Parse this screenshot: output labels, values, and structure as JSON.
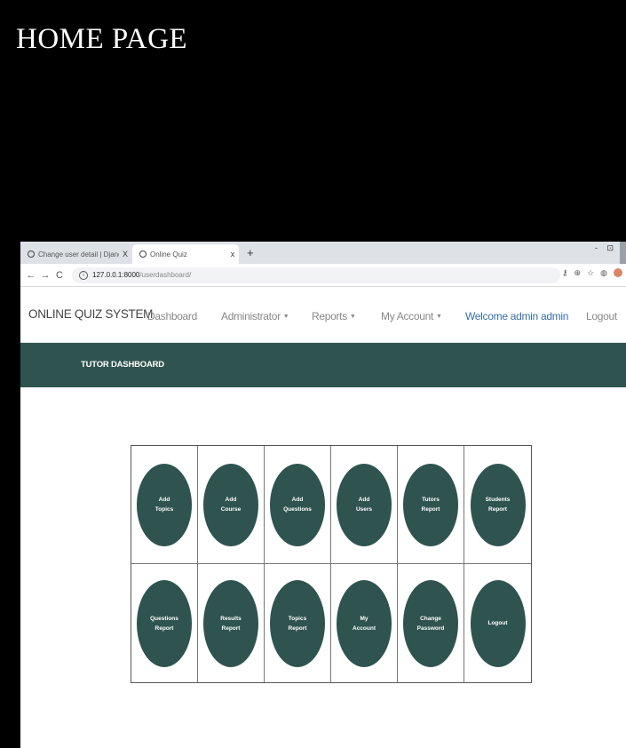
{
  "heading": "HOME PAGE",
  "browser": {
    "tabs": [
      {
        "label": "Change user detail | Django site",
        "close": "X"
      },
      {
        "label": "Online Quiz",
        "close": "x"
      }
    ],
    "new_tab": "+",
    "window_controls": "- ⊡",
    "url_host": "127.0.0.1:8000",
    "url_path": "/userdashboard/"
  },
  "navbar": {
    "brand": "ONLINE QUIZ SYSTEM",
    "links": [
      {
        "label": "Dashboard",
        "caret": false
      },
      {
        "label": "Administrator",
        "caret": true
      },
      {
        "label": "Reports",
        "caret": true
      },
      {
        "label": "My Account",
        "caret": true
      }
    ],
    "welcome": "Welcome admin admin",
    "logout": "Logout"
  },
  "banner": {
    "title": "TUTOR DASHBOARD"
  },
  "tiles": [
    "Add\nTopics",
    "Add\nCourse",
    "Add\nQuestions",
    "Add\nUsers",
    "Tutors\nReport",
    "Students\nReport",
    "Questions\nReport",
    "Results\nReport",
    "Topics\nReport",
    "My\nAccount",
    "Change\nPassword",
    "Logout"
  ],
  "colors": {
    "accent": "#2f5450",
    "welcome": "#3a6fa8",
    "background": "#000000"
  }
}
